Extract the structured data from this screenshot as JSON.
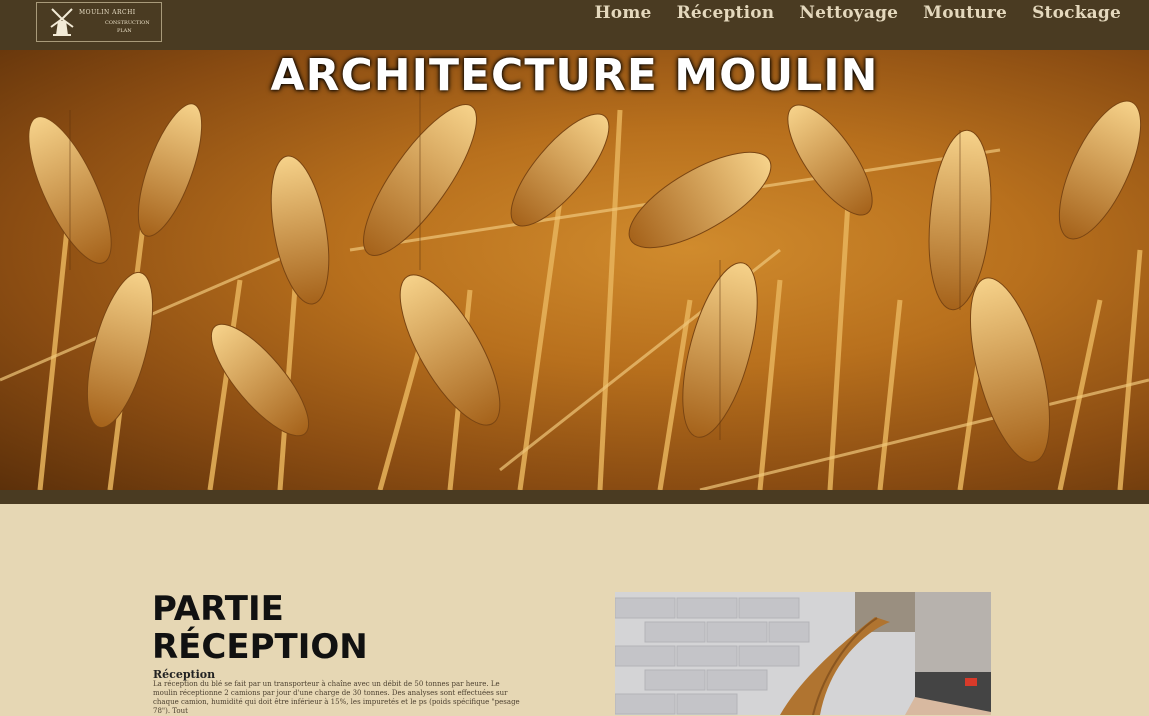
{
  "logo": {
    "alt": "Moulin logo",
    "line1": "MOULIN ARCHI",
    "line2": "CONSTRUCTION",
    "line3": "PLAN"
  },
  "nav": {
    "items": [
      "Home",
      "Réception",
      "Nettoyage",
      "Mouture",
      "Stockage"
    ]
  },
  "hero": {
    "title": "ARCHITECTURE MOULIN"
  },
  "section": {
    "heading_line1": "PARTIE",
    "heading_line2": "RÉCEPTION",
    "subheading": "Réception",
    "paragraph": "La réception du blé se fait par un transporteur à chaîne avec un débit de 50 tonnes par heure. Le moulin réceptionne 2 camions par jour d'une charge de 30 tonnes. Des analyses sont effectuées sur chaque camion, humidité qui doit être inférieur à 15%, les impuretés et le ps (poids spécifique \"pesage 78\"). Tout"
  },
  "colors": {
    "topbar": "#4a3b22",
    "background": "#e6d7b4",
    "nav_text": "#e4d8bd"
  }
}
